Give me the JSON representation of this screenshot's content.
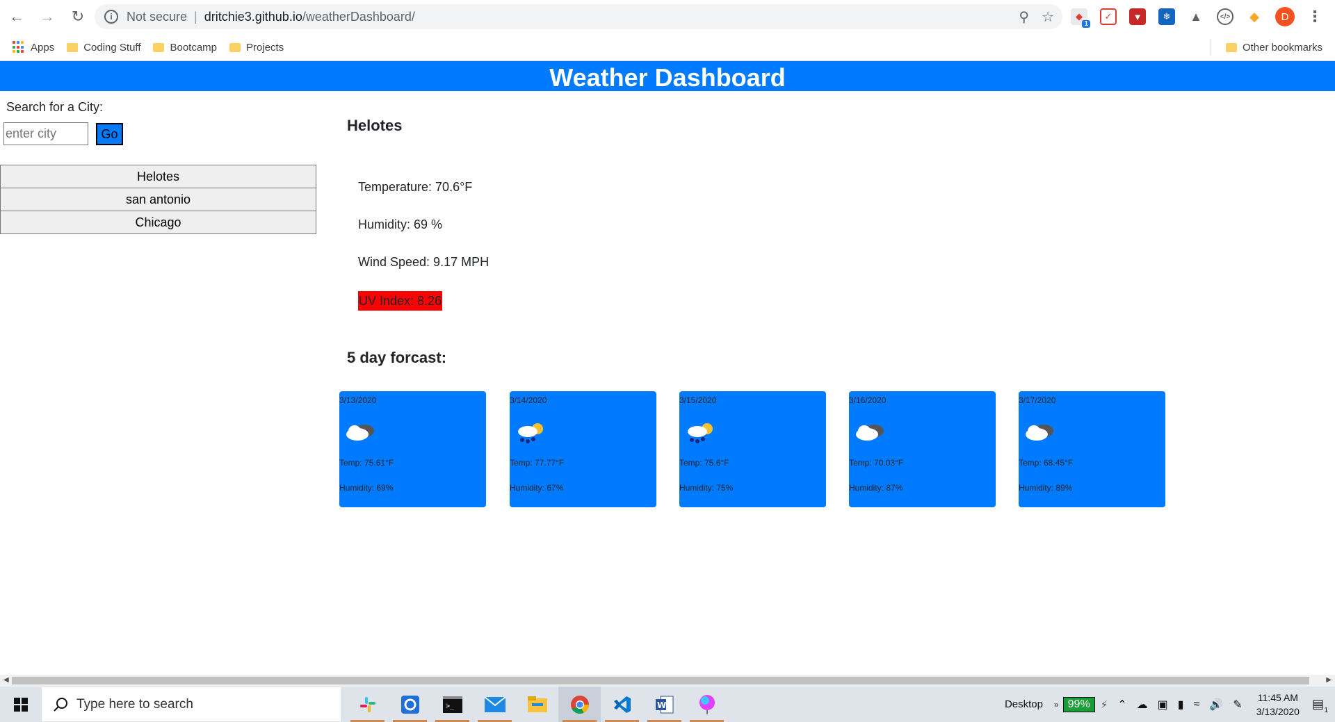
{
  "browser": {
    "security_label": "Not secure",
    "url_host": "dritchie3.github.io",
    "url_path": "/weatherDashboard/",
    "profile_initial": "D",
    "extension_badge": "1",
    "bookmarks": [
      {
        "label": "Apps"
      },
      {
        "label": "Coding Stuff"
      },
      {
        "label": "Bootcamp"
      },
      {
        "label": "Projects"
      }
    ],
    "other_bookmarks": "Other bookmarks"
  },
  "app": {
    "title": "Weather Dashboard",
    "accent_color": "#007bff",
    "search_label": "Search for a City:",
    "search_placeholder": "enter city",
    "go_label": "Go",
    "history": [
      "Helotes",
      "san antonio",
      "Chicago"
    ]
  },
  "current": {
    "city": "Helotes",
    "temperature": "Temperature: 70.6°F",
    "humidity": "Humidity: 69 %",
    "wind": "Wind Speed: 9.17 MPH",
    "uv": "UV Index: 8.26",
    "uv_color": "#ff0000"
  },
  "forecast": {
    "title": "5 day forcast:",
    "days": [
      {
        "date": "3/13/2020",
        "icon": "cloudy-icon",
        "temp": "Temp: 75.61°F",
        "humidity": "Humidity: 69%"
      },
      {
        "date": "3/14/2020",
        "icon": "rain-sun-icon",
        "temp": "Temp: 77.77°F",
        "humidity": "Humidity: 67%"
      },
      {
        "date": "3/15/2020",
        "icon": "rain-sun-icon",
        "temp": "Temp: 75.6°F",
        "humidity": "Humidity: 75%"
      },
      {
        "date": "3/16/2020",
        "icon": "cloudy-icon",
        "temp": "Temp: 70.03°F",
        "humidity": "Humidity: 87%"
      },
      {
        "date": "3/17/2020",
        "icon": "cloudy-icon",
        "temp": "Temp: 68.45°F",
        "humidity": "Humidity: 89%"
      }
    ]
  },
  "taskbar": {
    "search_placeholder": "Type here to search",
    "desktop_label": "Desktop",
    "battery": "99%",
    "time": "11:45 AM",
    "date": "3/13/2020",
    "notification_count": "1"
  }
}
